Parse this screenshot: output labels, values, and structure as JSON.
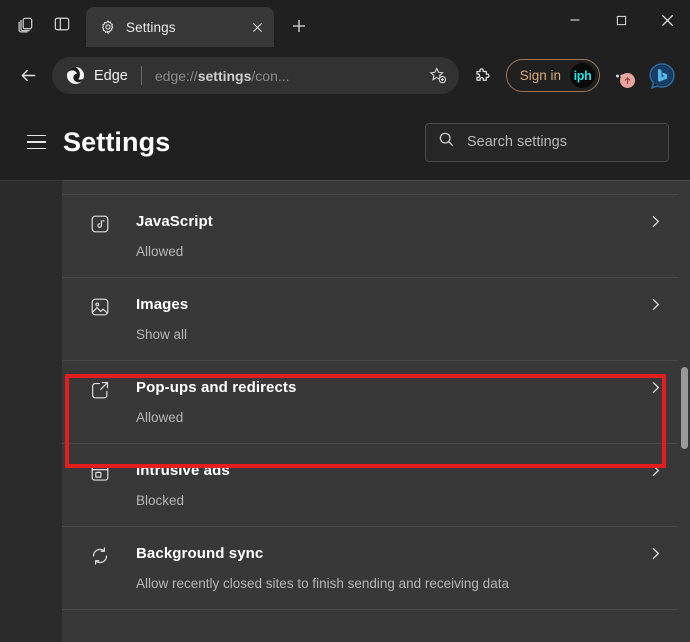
{
  "window": {
    "tab_search_icon": "tab-copies-icon",
    "split_screen_icon": "split-screen-icon",
    "minimize_label": "–",
    "maximize_label": "□",
    "close_label": "✕"
  },
  "tab": {
    "favicon": "gear-icon",
    "title": "Settings",
    "close_label": "✕",
    "new_tab_label": "+"
  },
  "navbar": {
    "back_icon": "arrow-left-icon",
    "brand": "Edge",
    "url": "edge://settings/con...",
    "url_bold_part": "settings",
    "url_prefix": "edge://",
    "url_suffix": "/con...",
    "favorite_icon": "star-add-icon",
    "extensions_icon": "puzzle-piece-icon",
    "signin_label": "Sign in",
    "avatar_initials": "iph",
    "avatar_text_color": "#22e3e0",
    "signin_border_color": "#9b7a5e",
    "signin_text_color": "#d8ab7c",
    "menu_icon": "ellipsis-icon",
    "update_badge_icon": "arrow-up-icon",
    "update_badge_color": "#e8a4a0",
    "copilot_icon": "bing-copilot-icon"
  },
  "settings": {
    "menu_icon": "hamburger-icon",
    "title": "Settings",
    "search_icon": "search-icon",
    "search_placeholder": "Search settings",
    "search_value": ""
  },
  "permissions": {
    "rows": [
      {
        "icon": "javascript-icon",
        "title": "JavaScript",
        "status": "Allowed",
        "chevron": "chevron-right-icon",
        "highlighted": false
      },
      {
        "icon": "image-icon",
        "title": "Images",
        "status": "Show all",
        "chevron": "chevron-right-icon",
        "highlighted": false
      },
      {
        "icon": "external-link-icon",
        "title": "Pop-ups and redirects",
        "status": "Allowed",
        "chevron": "chevron-right-icon",
        "highlighted": true
      },
      {
        "icon": "ad-window-icon",
        "title": "Intrusive ads",
        "status": "Blocked",
        "chevron": "chevron-right-icon",
        "highlighted": false
      },
      {
        "icon": "sync-icon",
        "title": "Background sync",
        "status": "Allow recently closed sites to finish sending and receiving data",
        "chevron": "chevron-right-icon",
        "highlighted": false
      }
    ]
  },
  "annotation": {
    "color": "#e71d1d",
    "target": "Pop-ups and redirects"
  },
  "scrollbar": {
    "thumb_color": "#9a9a9a"
  }
}
